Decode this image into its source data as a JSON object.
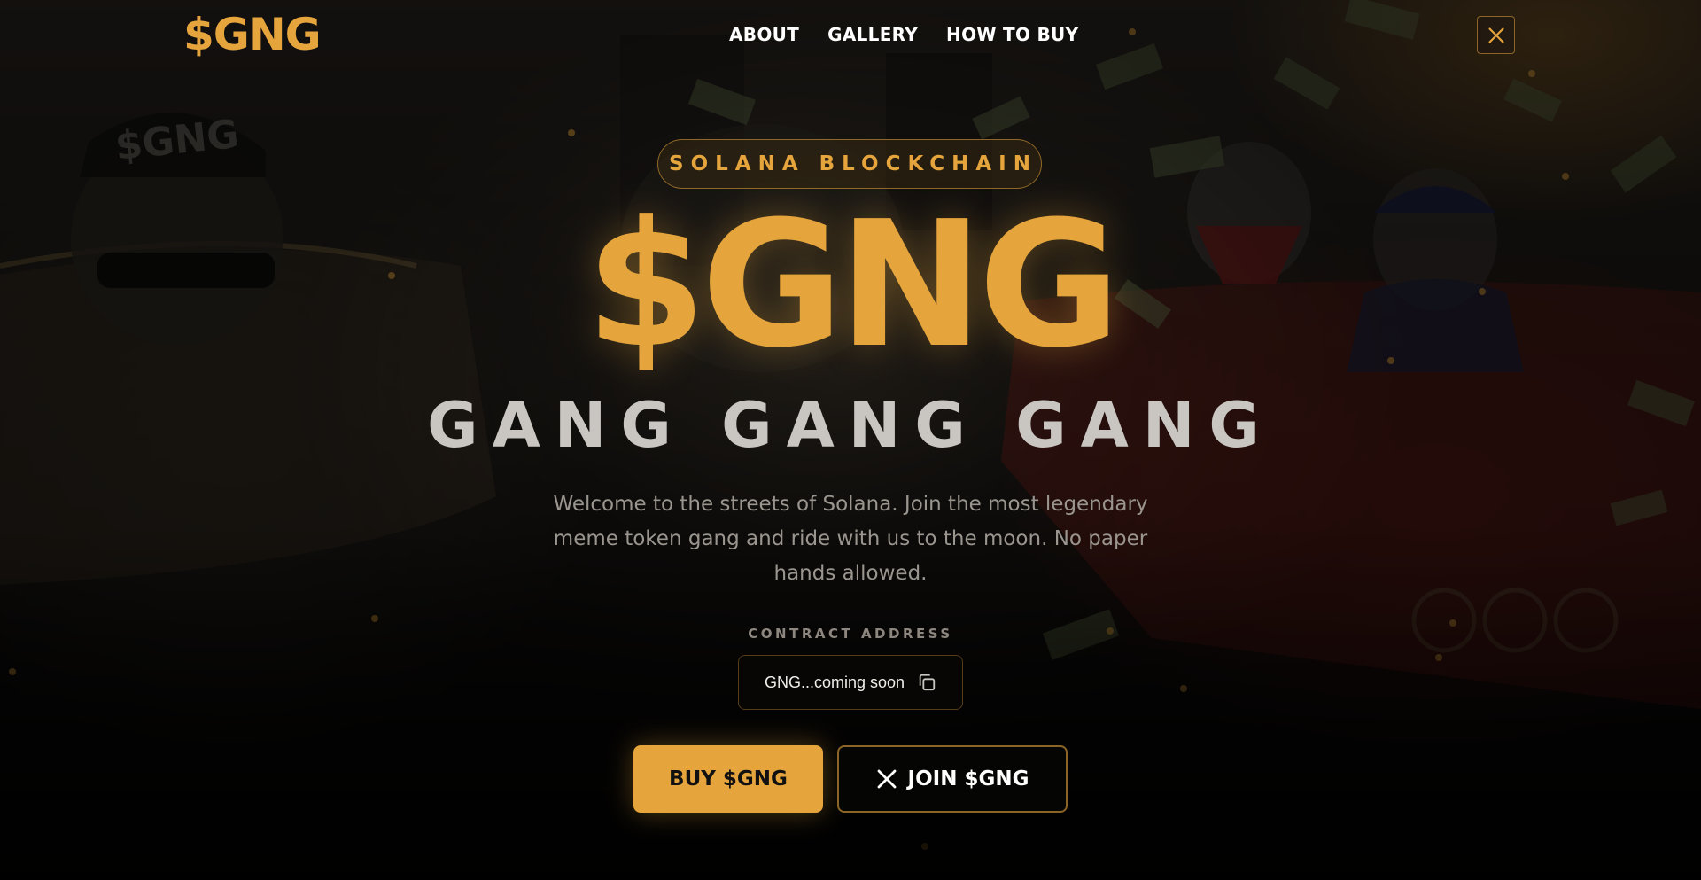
{
  "brand": {
    "logo_text": "$GNG",
    "accent_color": "#e5a53c"
  },
  "nav": {
    "items": [
      {
        "label": "ABOUT"
      },
      {
        "label": "GALLERY"
      },
      {
        "label": "HOW TO BUY"
      }
    ],
    "x_link_icon": "x-logo-icon"
  },
  "hero": {
    "badge": "SOLANA BLOCKCHAIN",
    "title": "$GNG",
    "subtitle": "GANG GANG GANG",
    "description": "Welcome to the streets of Solana. Join the most legendary meme token gang and ride with us to the moon. No paper hands allowed.",
    "contract_label": "CONTRACT ADDRESS",
    "contract_address": "GNG...coming soon",
    "copy_icon": "copy-icon",
    "buy_button": "BUY $GNG",
    "join_button": "JOIN $GNG",
    "join_icon": "x-logo-icon"
  },
  "background": {
    "illustration": "gangster-lowrider-scene",
    "cap_text": "$GNG"
  }
}
